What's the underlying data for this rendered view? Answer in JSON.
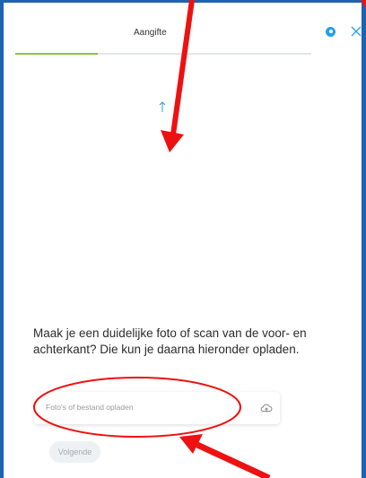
{
  "header": {
    "title": "Aangifte",
    "help_icon": "help-icon",
    "close_icon": "close-icon"
  },
  "progress": {
    "fraction": 0.28,
    "fill_color": "#8fc13f"
  },
  "content": {
    "up_icon": "arrow-up-icon",
    "instruction": "Maak je een duidelijke foto of scan van de voor- en achterkant? Die kun je daarna hieronder opladen."
  },
  "upload": {
    "label": "Foto's of bestand opladen",
    "icon": "cloud-upload-icon"
  },
  "actions": {
    "next_label": "Volgende"
  },
  "colors": {
    "frame_border": "#1e62b4",
    "accent": "#27a0e6",
    "annotation_red": "#ee1111"
  }
}
